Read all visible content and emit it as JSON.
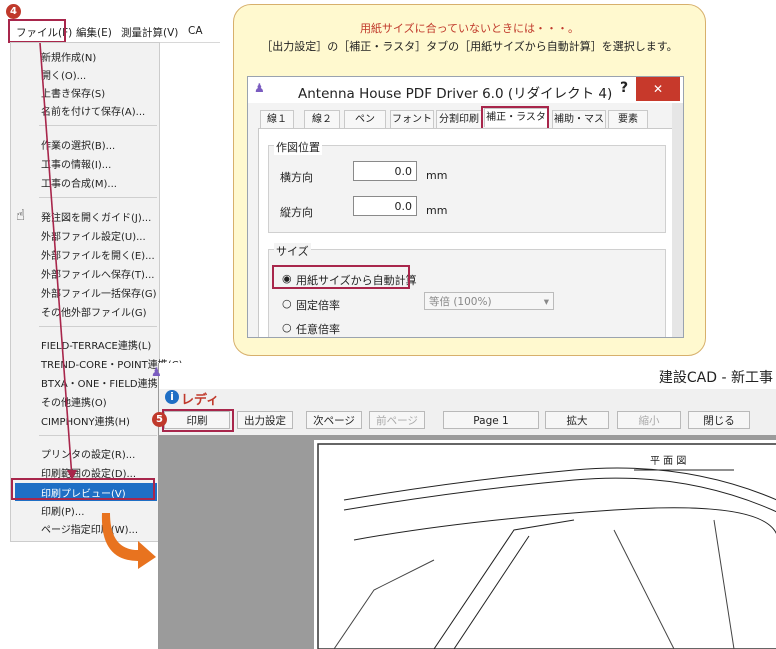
{
  "menubar": {
    "file": "ファイル(F)",
    "edit": "編集(E)",
    "survey": "測量計算(V)",
    "ca": "CA"
  },
  "menu": {
    "items": [
      "新規作成(N)",
      "開く(O)...",
      "上書き保存(S)",
      "名前を付けて保存(A)...",
      "作業の選択(B)...",
      "工事の情報(I)...",
      "工事の合成(M)...",
      "発注図を開くガイド(J)...",
      "外部ファイル設定(U)...",
      "外部ファイルを開く(E)...",
      "外部ファイルへ保存(T)...",
      "外部ファイル一括保存(G)",
      "その他外部ファイル(G)",
      "FIELD-TERRACE連携(L)",
      "TREND-CORE・POINT連携(C)",
      "BTXA・ONE・FIELD連携(X)",
      "その他連携(O)",
      "CIMPHONY連携(H)",
      "プリンタの設定(R)...",
      "印刷範囲の設定(D)...",
      "印刷プレビュー(V)",
      "印刷(P)...",
      "ページ指定印刷(W)..."
    ]
  },
  "badges": {
    "step4": "4",
    "step5": "5"
  },
  "callout": {
    "line1": "用紙サイズに合っていないときには・・・。",
    "line2": "［出力設定］の［補正・ラスタ］タブの［用紙サイズから自動計算］を選択します。"
  },
  "dialog": {
    "title": "Antenna House PDF Driver 6.0 (リダイレクト 4)",
    "help": "?",
    "close": "✕",
    "tabs": [
      "線１",
      "線２",
      "ペン",
      "フォント",
      "分割印刷",
      "補正・ラスタ",
      "補助・マスク",
      "要素"
    ],
    "position_group": "作図位置",
    "horizontal_label": "横方向",
    "horizontal_value": "0.0",
    "vertical_label": "縦方向",
    "vertical_value": "0.0",
    "unit": "mm",
    "size_group": "サイズ",
    "radio_auto": "用紙サイズから自動計算",
    "radio_fixed": "固定倍率",
    "fixed_select": "等倍 (100%)",
    "radio_any": "任意倍率"
  },
  "mainwin": {
    "title": "建設CAD - 新工事",
    "status": "レディ",
    "buttons": {
      "print": "印刷",
      "output": "出力設定",
      "next": "次ページ",
      "prev": "前ページ",
      "page": "Page 1",
      "zoomin": "拡大",
      "zoomout": "縮小",
      "close": "閉じる"
    },
    "drawing_title": "平 面 図"
  },
  "colors": {
    "accent_red": "#c0392b",
    "highlight": "#1f6fc5",
    "callout_bg": "#fff9cf",
    "orange_arrow": "#e8731f"
  }
}
